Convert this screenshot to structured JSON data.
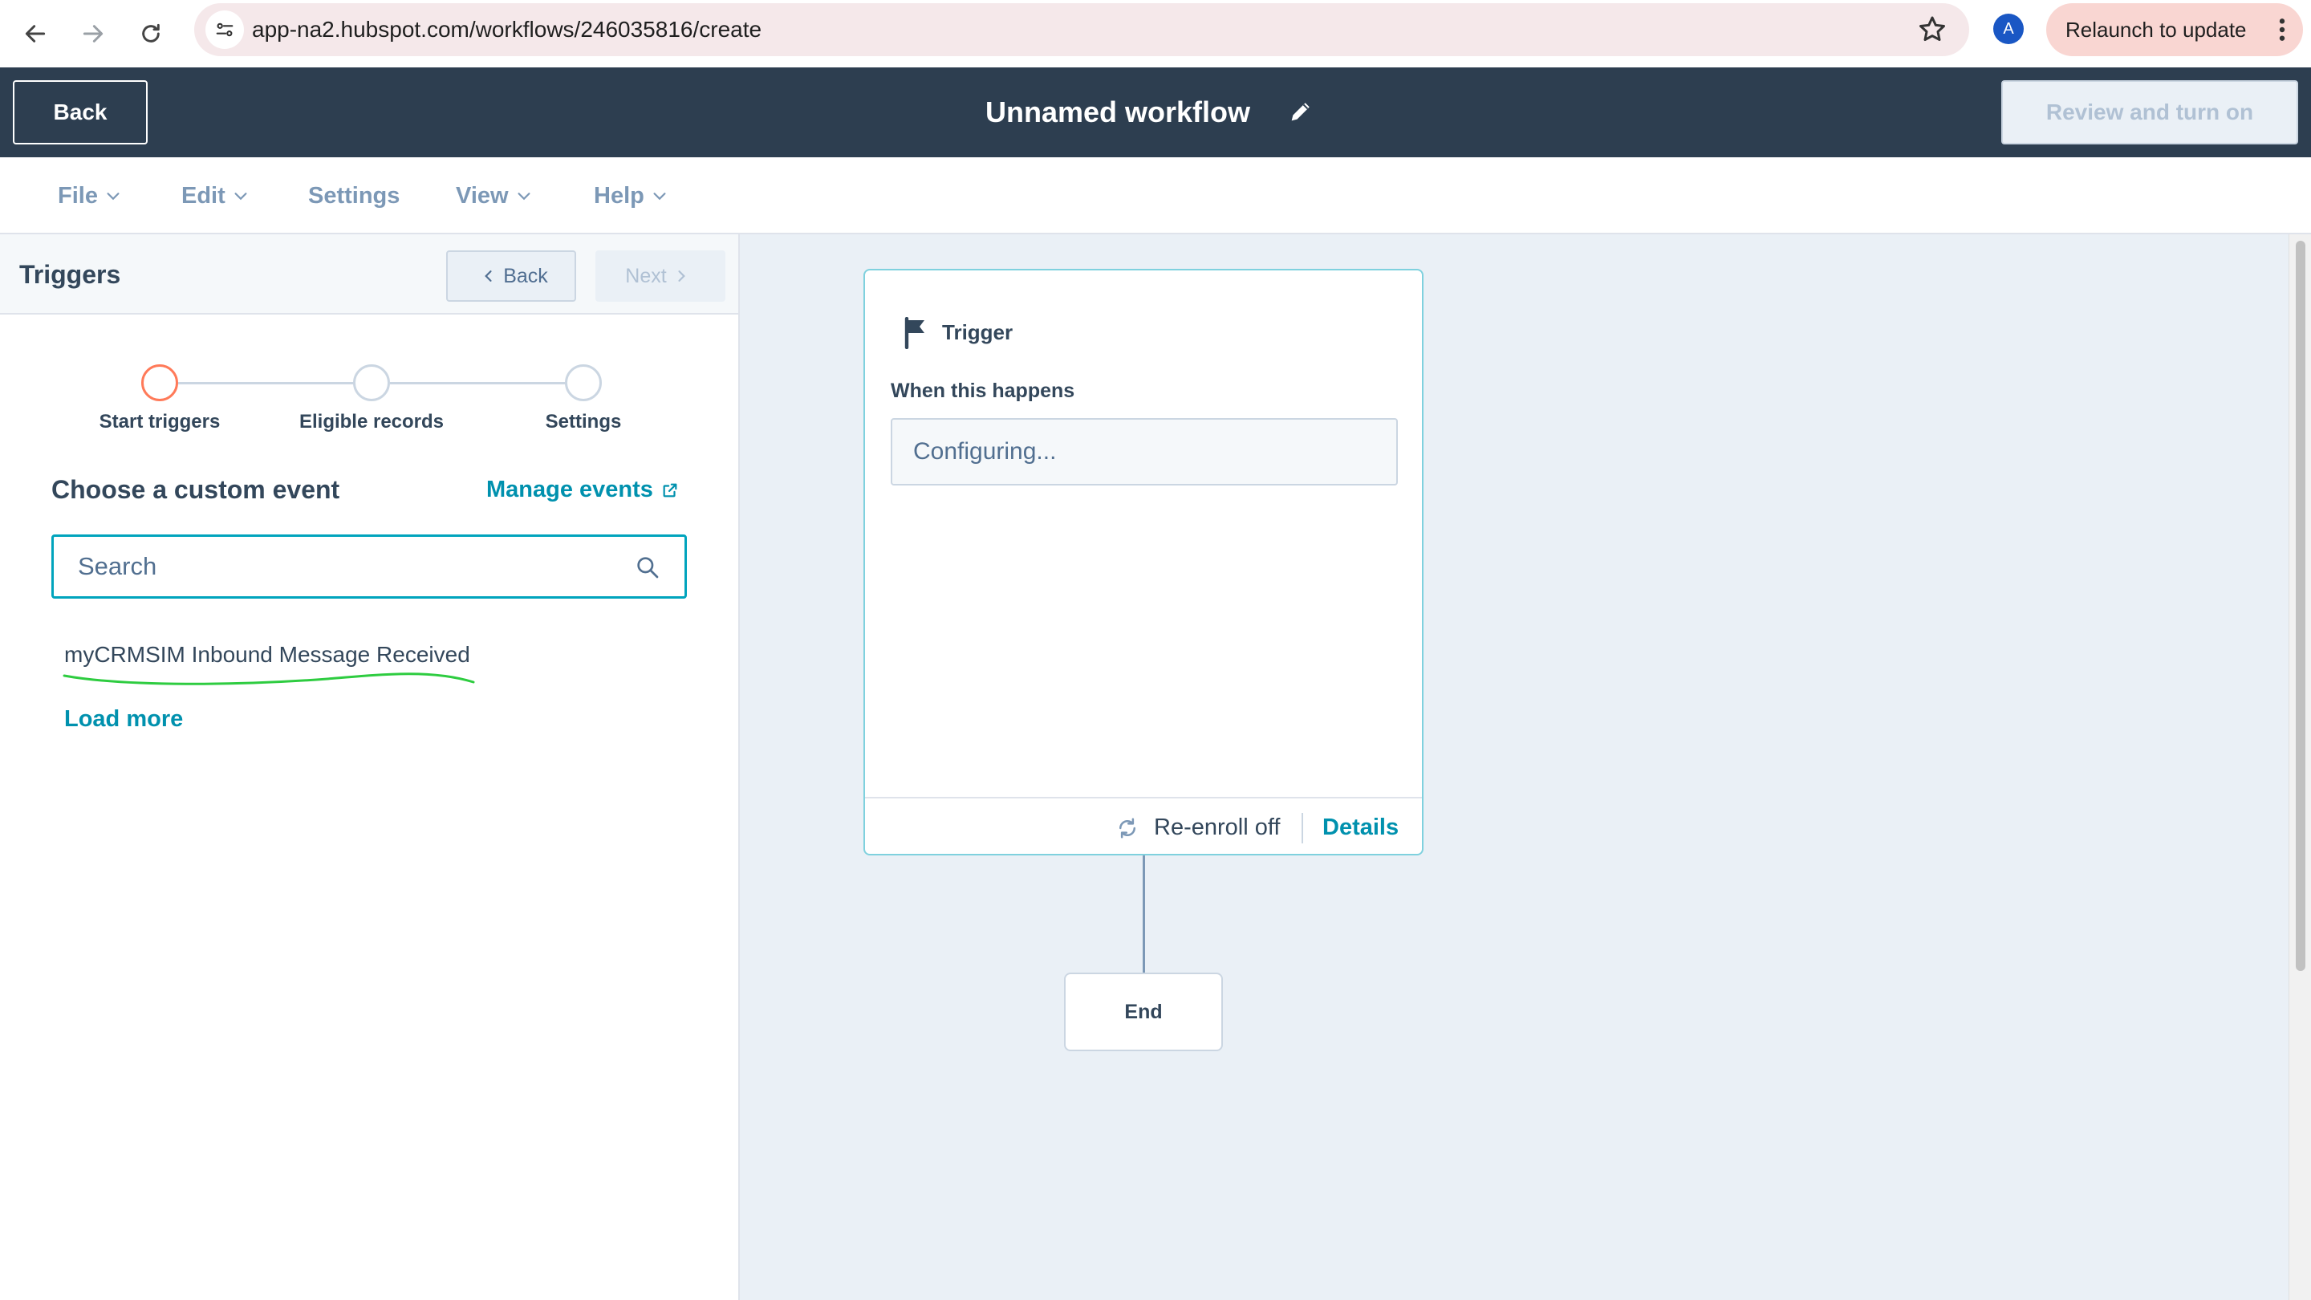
{
  "browser": {
    "url": "app-na2.hubspot.com/workflows/246035816/create",
    "avatar_letter": "A",
    "relaunch_label": "Relaunch to update"
  },
  "header": {
    "back_label": "Back",
    "workflow_title": "Unnamed workflow",
    "review_label": "Review and turn on"
  },
  "menu": {
    "items": [
      {
        "label": "File",
        "has_dropdown": true
      },
      {
        "label": "Edit",
        "has_dropdown": true
      },
      {
        "label": "Settings",
        "has_dropdown": false
      },
      {
        "label": "View",
        "has_dropdown": true
      },
      {
        "label": "Help",
        "has_dropdown": true
      }
    ]
  },
  "panel": {
    "title": "Triggers",
    "back_label": "Back",
    "next_label": "Next",
    "steps": [
      {
        "label": "Start triggers",
        "active": true
      },
      {
        "label": "Eligible records",
        "active": false
      },
      {
        "label": "Settings",
        "active": false
      }
    ],
    "choose_title": "Choose a custom event",
    "manage_link": "Manage events",
    "search_placeholder": "Search",
    "events": [
      "myCRMSIM Inbound Message Received"
    ],
    "load_more": "Load more"
  },
  "canvas": {
    "trigger_title": "Trigger",
    "when_label": "When this happens",
    "config_text": "Configuring...",
    "reenroll_label": "Re-enroll off",
    "details_label": "Details",
    "end_label": "End"
  },
  "colors": {
    "header_bg": "#2d3e50",
    "accent_link": "#0091ae",
    "step_active": "#ff7a59",
    "canvas_bg": "#eaf0f6",
    "card_border": "#7fd1de"
  }
}
